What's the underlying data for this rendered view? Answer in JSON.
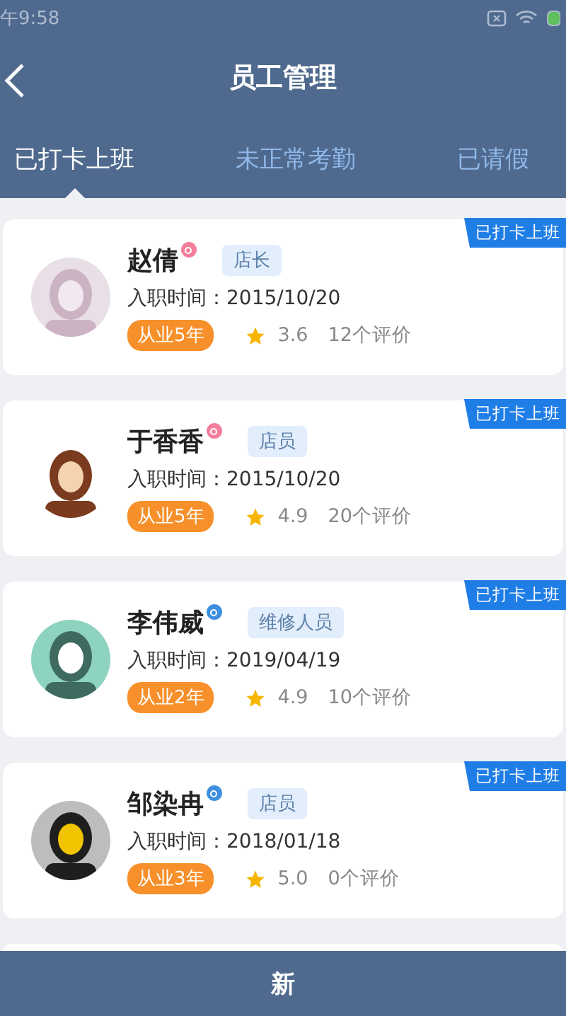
{
  "status_bar": {
    "time": "午9:58"
  },
  "header": {
    "title": "员工管理"
  },
  "tabs": [
    {
      "label": "已打卡上班",
      "selected": true
    },
    {
      "label": "未正常考勤",
      "selected": false
    },
    {
      "label": "已请假",
      "selected": false
    }
  ],
  "employees": [
    {
      "name": "赵倩",
      "color": "#f47f9c",
      "role": "店长",
      "hire_label": "入职时间：",
      "hire_date": "2015/10/20",
      "experience": "从业5年",
      "rating": "3.6",
      "reviews": "12个评价",
      "status": "已打卡上班"
    },
    {
      "name": "于香香",
      "color": "#f47f9c",
      "role": "店员",
      "hire_label": "入职时间：",
      "hire_date": "2015/10/20",
      "experience": "从业5年",
      "rating": "4.9",
      "reviews": "20个评价",
      "status": "已打卡上班"
    },
    {
      "name": "李伟威",
      "color": "#3d8fe0",
      "role": "维修人员",
      "hire_label": "入职时间：",
      "hire_date": "2019/04/19",
      "experience": "从业2年",
      "rating": "4.9",
      "reviews": "10个评价",
      "status": "已打卡上班"
    },
    {
      "name": "邹染冉",
      "color": "#3d8fe0",
      "role": "店员",
      "hire_label": "入职时间：",
      "hire_date": "2018/01/18",
      "experience": "从业3年",
      "rating": "5.0",
      "reviews": "0个评价",
      "status": "已打卡上班"
    }
  ],
  "bottom_bar": {
    "label": "新"
  }
}
